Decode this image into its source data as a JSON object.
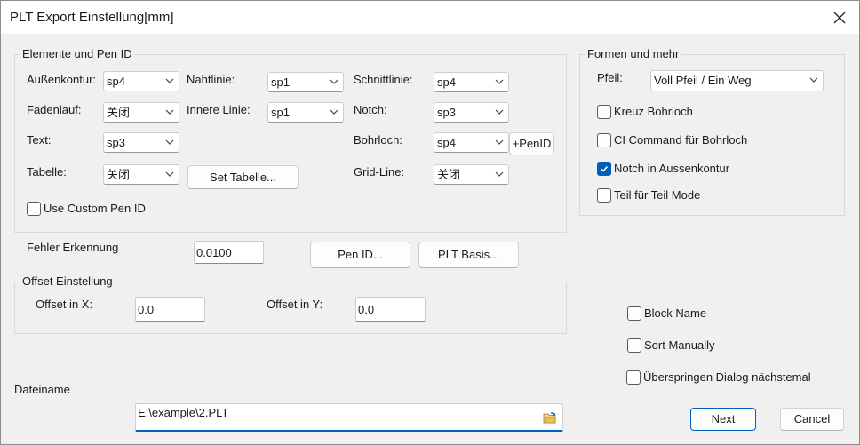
{
  "window": {
    "title": "PLT Export Einstellung[mm]",
    "close_icon": "close-icon"
  },
  "colors": {
    "accent": "#005fb8",
    "background": "#f0f0f0"
  },
  "pen_group": {
    "title": "Elemente und Pen ID",
    "aussenkontur": {
      "label": "Außenkontur:",
      "value": "sp4"
    },
    "nahtlinie": {
      "label": "Nahtlinie:",
      "value": "sp1"
    },
    "schnittlinie": {
      "label": "Schnittlinie:",
      "value": "sp4"
    },
    "fadenlauf": {
      "label": "Fadenlauf:",
      "value": "关闭"
    },
    "innere_linie": {
      "label": "Innere Linie:",
      "value": "sp1"
    },
    "notch": {
      "label": "Notch:",
      "value": "sp3"
    },
    "text": {
      "label": "Text:",
      "value": "sp3"
    },
    "bohrloch": {
      "label": "Bohrloch:",
      "value": "sp4"
    },
    "tabelle": {
      "label": "Tabelle:",
      "value": "关闭"
    },
    "grid_line": {
      "label": "Grid-Line:",
      "value": "关闭"
    },
    "add_pen_id_button": "+PenID",
    "set_tabelle_button": "Set Tabelle...",
    "use_custom_pen_id": {
      "label": "Use Custom Pen ID",
      "checked": false
    }
  },
  "fehler_erkennung": {
    "label": "Fehler Erkennung",
    "value": "0.0100"
  },
  "pen_id_button": "Pen ID...",
  "plt_basis_button": "PLT Basis...",
  "offset_group": {
    "title": "Offset Einstellung",
    "x": {
      "label": "Offset in X:",
      "value": "0.0"
    },
    "y": {
      "label": "Offset in Y:",
      "value": "0.0"
    }
  },
  "formen_group": {
    "title": "Formen und mehr",
    "pfeil": {
      "label": "Pfeil:",
      "value": "Voll Pfeil / Ein Weg"
    },
    "options": [
      {
        "label": "Kreuz Bohrloch",
        "checked": false
      },
      {
        "label": "CI Command für Bohrloch",
        "checked": false
      },
      {
        "label": "Notch in Aussenkontur",
        "checked": true
      },
      {
        "label": "Teil für Teil Mode",
        "checked": false
      }
    ]
  },
  "extra_options": [
    {
      "label": "Block Name",
      "checked": false
    },
    {
      "label": "Sort Manually",
      "checked": false
    },
    {
      "label": "Überspringen Dialog nächstemal",
      "checked": false
    }
  ],
  "dateiname": {
    "label": "Dateiname",
    "value": "E:\\example\\2.PLT",
    "icon": "folder-open-icon"
  },
  "footer": {
    "next_label": "Next",
    "cancel_label": "Cancel"
  }
}
